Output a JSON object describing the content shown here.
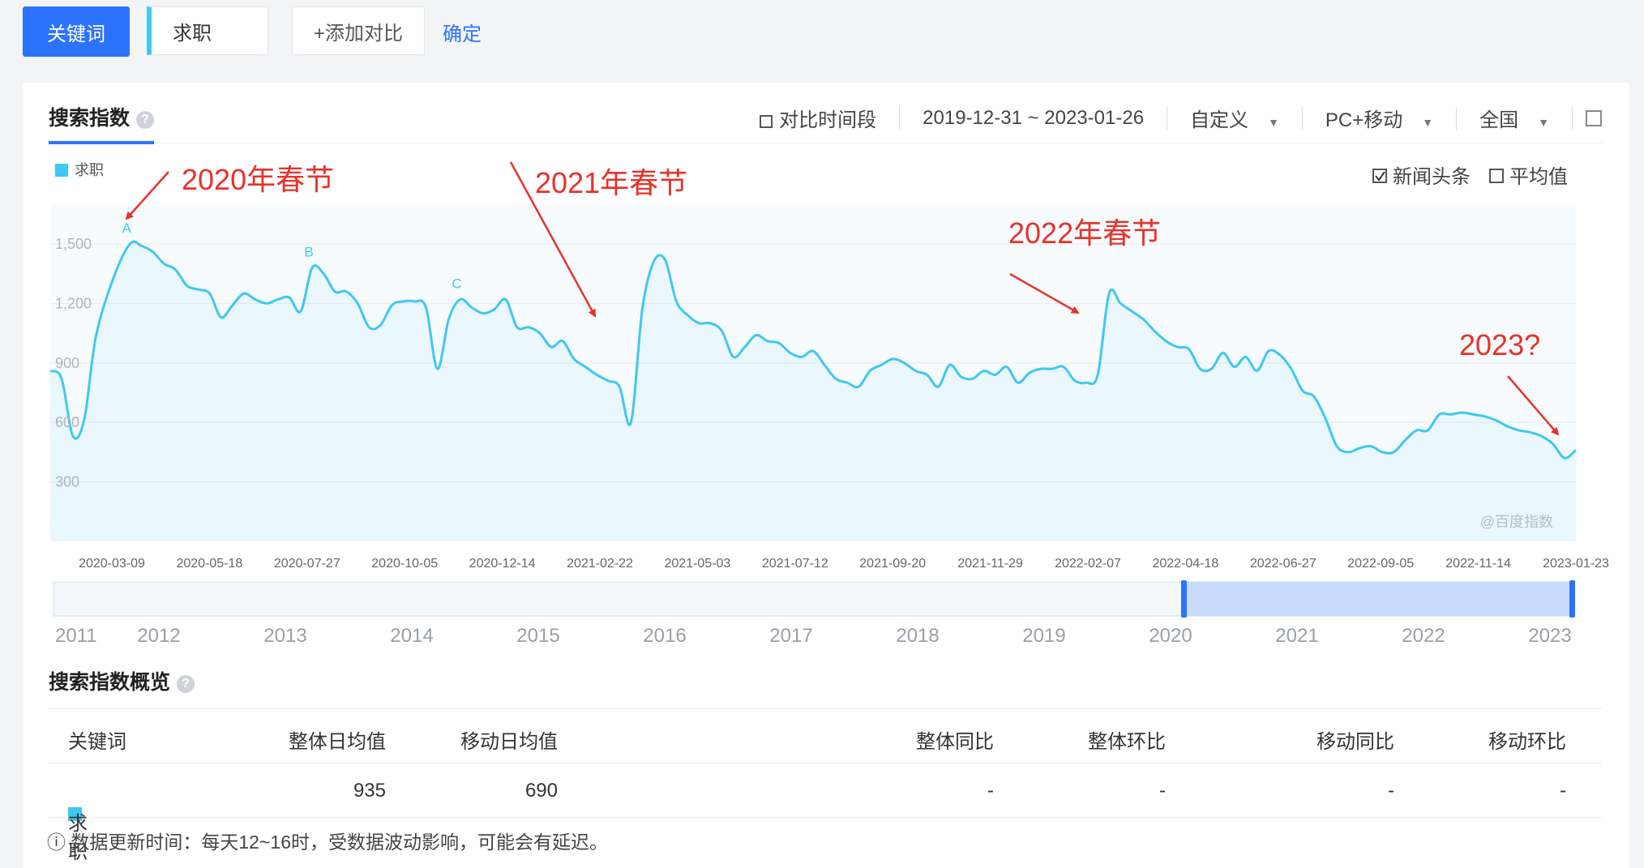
{
  "toolbar": {
    "keyword_button": "关键词",
    "keyword_value": "求职",
    "add_compare": "+添加对比",
    "confirm": "确定"
  },
  "card": {
    "title": "搜索指数",
    "compare_period": "对比时间段",
    "date_range": "2019-12-31 ~ 2023-01-26",
    "custom": "自定义",
    "platform": "PC+移动",
    "region": "全国"
  },
  "chart_data": {
    "type": "area",
    "series": [
      {
        "name": "求职",
        "color": "#3ec8f2",
        "points": [
          [
            0,
            860
          ],
          [
            2,
            820
          ],
          [
            4,
            530
          ],
          [
            6,
            620
          ],
          [
            8,
            1030
          ],
          [
            11,
            1320
          ],
          [
            14,
            1500
          ],
          [
            16,
            1490
          ],
          [
            18,
            1460
          ],
          [
            20,
            1400
          ],
          [
            22,
            1370
          ],
          [
            24,
            1290
          ],
          [
            26,
            1270
          ],
          [
            28,
            1250
          ],
          [
            30,
            1130
          ],
          [
            32,
            1190
          ],
          [
            34,
            1250
          ],
          [
            36,
            1220
          ],
          [
            38,
            1200
          ],
          [
            40,
            1220
          ],
          [
            42,
            1230
          ],
          [
            44,
            1160
          ],
          [
            46,
            1380
          ],
          [
            48,
            1350
          ],
          [
            50,
            1260
          ],
          [
            52,
            1260
          ],
          [
            54,
            1200
          ],
          [
            56,
            1080
          ],
          [
            58,
            1090
          ],
          [
            60,
            1190
          ],
          [
            62,
            1210
          ],
          [
            64,
            1210
          ],
          [
            66,
            1180
          ],
          [
            68,
            870
          ],
          [
            70,
            1120
          ],
          [
            72,
            1220
          ],
          [
            74,
            1180
          ],
          [
            76,
            1150
          ],
          [
            78,
            1170
          ],
          [
            80,
            1220
          ],
          [
            82,
            1080
          ],
          [
            84,
            1080
          ],
          [
            86,
            1050
          ],
          [
            88,
            980
          ],
          [
            90,
            1010
          ],
          [
            92,
            920
          ],
          [
            94,
            880
          ],
          [
            96,
            840
          ],
          [
            98,
            810
          ],
          [
            100,
            780
          ],
          [
            102,
            600
          ],
          [
            104,
            1170
          ],
          [
            106,
            1410
          ],
          [
            108,
            1420
          ],
          [
            110,
            1210
          ],
          [
            112,
            1140
          ],
          [
            114,
            1100
          ],
          [
            116,
            1100
          ],
          [
            118,
            1060
          ],
          [
            120,
            930
          ],
          [
            122,
            980
          ],
          [
            124,
            1040
          ],
          [
            126,
            1010
          ],
          [
            128,
            1000
          ],
          [
            130,
            950
          ],
          [
            132,
            930
          ],
          [
            134,
            960
          ],
          [
            136,
            890
          ],
          [
            138,
            820
          ],
          [
            140,
            800
          ],
          [
            142,
            780
          ],
          [
            144,
            860
          ],
          [
            146,
            890
          ],
          [
            148,
            920
          ],
          [
            150,
            900
          ],
          [
            152,
            860
          ],
          [
            154,
            840
          ],
          [
            156,
            780
          ],
          [
            158,
            890
          ],
          [
            160,
            830
          ],
          [
            162,
            820
          ],
          [
            164,
            860
          ],
          [
            166,
            840
          ],
          [
            168,
            880
          ],
          [
            170,
            800
          ],
          [
            172,
            850
          ],
          [
            174,
            870
          ],
          [
            176,
            870
          ],
          [
            178,
            880
          ],
          [
            180,
            810
          ],
          [
            182,
            800
          ],
          [
            184,
            840
          ],
          [
            186,
            1250
          ],
          [
            188,
            1200
          ],
          [
            190,
            1160
          ],
          [
            192,
            1120
          ],
          [
            194,
            1060
          ],
          [
            196,
            1010
          ],
          [
            198,
            980
          ],
          [
            200,
            970
          ],
          [
            202,
            870
          ],
          [
            204,
            870
          ],
          [
            206,
            950
          ],
          [
            208,
            880
          ],
          [
            210,
            930
          ],
          [
            212,
            860
          ],
          [
            214,
            960
          ],
          [
            216,
            940
          ],
          [
            218,
            870
          ],
          [
            220,
            760
          ],
          [
            222,
            730
          ],
          [
            224,
            620
          ],
          [
            226,
            480
          ],
          [
            228,
            450
          ],
          [
            230,
            470
          ],
          [
            232,
            480
          ],
          [
            234,
            450
          ],
          [
            236,
            450
          ],
          [
            238,
            510
          ],
          [
            240,
            560
          ],
          [
            242,
            560
          ],
          [
            244,
            640
          ],
          [
            246,
            640
          ],
          [
            248,
            650
          ],
          [
            250,
            640
          ],
          [
            252,
            630
          ],
          [
            254,
            610
          ],
          [
            256,
            580
          ],
          [
            258,
            560
          ],
          [
            260,
            550
          ],
          [
            262,
            530
          ],
          [
            264,
            490
          ],
          [
            266,
            420
          ],
          [
            268,
            460
          ]
        ]
      }
    ],
    "y_ticks": [
      "1,500",
      "1,200",
      "900",
      "600",
      "300"
    ],
    "x_ticks": [
      "2020-03-09",
      "2020-05-18",
      "2020-07-27",
      "2020-10-05",
      "2020-12-14",
      "2021-02-22",
      "2021-05-03",
      "2021-07-12",
      "2021-09-20",
      "2021-11-29",
      "2022-02-07",
      "2022-04-18",
      "2022-06-27",
      "2022-09-05",
      "2022-11-14",
      "2023-01-23"
    ],
    "ylim": [
      0,
      1700
    ],
    "legend": "求职",
    "legend_position": "top-left",
    "peak_marks": [
      "A",
      "B",
      "C"
    ],
    "annotations": [
      "2020年春节",
      "2021年春节",
      "2022年春节",
      "2023?"
    ],
    "watermark": "@百度指数",
    "options": {
      "news_headlines": "新闻头条",
      "average": "平均值",
      "news_checked": true,
      "average_checked": false
    },
    "navigator_years": [
      "2011",
      "2012",
      "2013",
      "2014",
      "2015",
      "2016",
      "2017",
      "2018",
      "2019",
      "2020",
      "2021",
      "2022",
      "2023"
    ],
    "grid": true
  },
  "overview": {
    "title": "搜索指数概览",
    "headers": [
      "关键词",
      "整体日均值",
      "移动日均值",
      "整体同比",
      "整体环比",
      "移动同比",
      "移动环比"
    ],
    "rows": [
      {
        "keyword": "求职",
        "overall_avg": "935",
        "mobile_avg": "690",
        "overall_yoy": "-",
        "overall_mom": "-",
        "mobile_yoy": "-",
        "mobile_mom": "-"
      }
    ],
    "note": "数据更新时间：每天12~16时，受数据波动影响，可能会有延迟。"
  }
}
